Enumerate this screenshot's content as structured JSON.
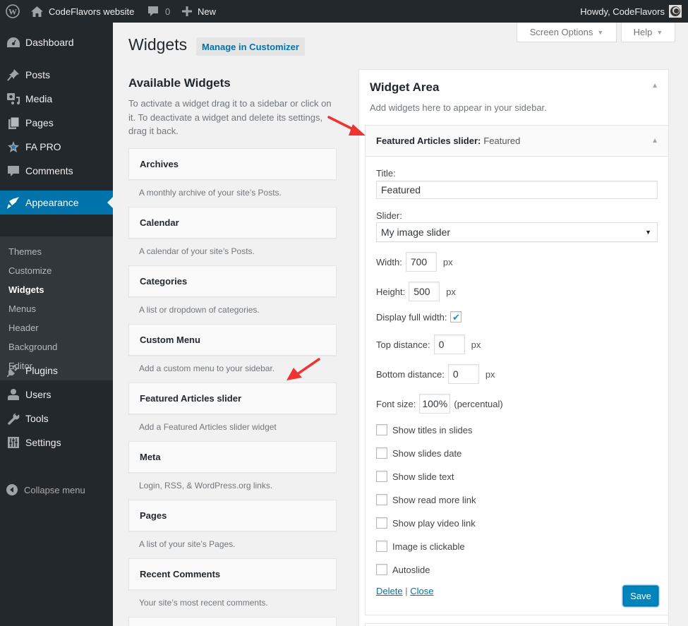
{
  "adminbar": {
    "site_name": "CodeFlavors website",
    "comments_count": "0",
    "new_label": "New",
    "greeting": "Howdy, CodeFlavors"
  },
  "sidebar": {
    "items": [
      {
        "label": "Dashboard",
        "icon": "dashboard-icon"
      },
      {
        "label": "Posts",
        "icon": "pin-icon"
      },
      {
        "label": "Media",
        "icon": "media-icon"
      },
      {
        "label": "Pages",
        "icon": "pages-icon"
      },
      {
        "label": "FA PRO",
        "icon": "star-icon"
      },
      {
        "label": "Comments",
        "icon": "comment-icon"
      },
      {
        "label": "Appearance",
        "icon": "brush-icon",
        "current": true
      },
      {
        "label": "Plugins",
        "icon": "plug-icon"
      },
      {
        "label": "Users",
        "icon": "user-icon"
      },
      {
        "label": "Tools",
        "icon": "wrench-icon"
      },
      {
        "label": "Settings",
        "icon": "sliders-icon"
      }
    ],
    "submenu": [
      "Themes",
      "Customize",
      "Widgets",
      "Menus",
      "Header",
      "Background",
      "Editor"
    ],
    "submenu_current": "Widgets",
    "collapse_label": "Collapse menu"
  },
  "screen_meta": {
    "screen_options": "Screen Options",
    "help": "Help"
  },
  "page": {
    "title": "Widgets",
    "customizer_button": "Manage in Customizer"
  },
  "available": {
    "heading": "Available Widgets",
    "description": "To activate a widget drag it to a sidebar or click on it. To deactivate a widget and delete its settings, drag it back.",
    "widgets": [
      {
        "name": "Archives",
        "desc": "A monthly archive of your site’s Posts."
      },
      {
        "name": "Calendar",
        "desc": "A calendar of your site’s Posts."
      },
      {
        "name": "Categories",
        "desc": "A list or dropdown of categories."
      },
      {
        "name": "Custom Menu",
        "desc": "Add a custom menu to your sidebar."
      },
      {
        "name": "Featured Articles slider",
        "desc": "Add a Featured Articles slider widget"
      },
      {
        "name": "Meta",
        "desc": "Login, RSS, & WordPress.org links."
      },
      {
        "name": "Pages",
        "desc": "A list of your site’s Pages."
      },
      {
        "name": "Recent Comments",
        "desc": "Your site’s most recent comments."
      }
    ]
  },
  "widget_area": {
    "title": "Widget Area",
    "description": "Add widgets here to appear in your sidebar.",
    "widget": {
      "name": "Featured Articles slider:",
      "instance_title": "Featured",
      "title_label": "Title:",
      "title_value": "Featured",
      "slider_label": "Slider:",
      "slider_value": "My image slider",
      "width_label": "Width:",
      "width_value": "700",
      "height_label": "Height:",
      "height_value": "500",
      "unit_px": "px",
      "full_width_label": "Display full width:",
      "full_width_checked": true,
      "top_label": "Top distance:",
      "top_value": "0",
      "bottom_label": "Bottom distance:",
      "bottom_value": "0",
      "font_label": "Font size:",
      "font_value": "100%",
      "font_unit": "(percentual)",
      "checkboxes": [
        {
          "label": "Show titles in slides",
          "checked": false
        },
        {
          "label": "Show slides date",
          "checked": false
        },
        {
          "label": "Show slide text",
          "checked": false
        },
        {
          "label": "Show read more link",
          "checked": false
        },
        {
          "label": "Show play video link",
          "checked": false
        },
        {
          "label": "Image is clickable",
          "checked": false
        },
        {
          "label": "Autoslide",
          "checked": false
        }
      ],
      "delete_label": "Delete",
      "separator": "|",
      "close_label": "Close",
      "save_label": "Save"
    }
  },
  "colors": {
    "accent": "#0073aa",
    "adminbar": "#23282d",
    "annotation_arrow": "#ee3333"
  }
}
